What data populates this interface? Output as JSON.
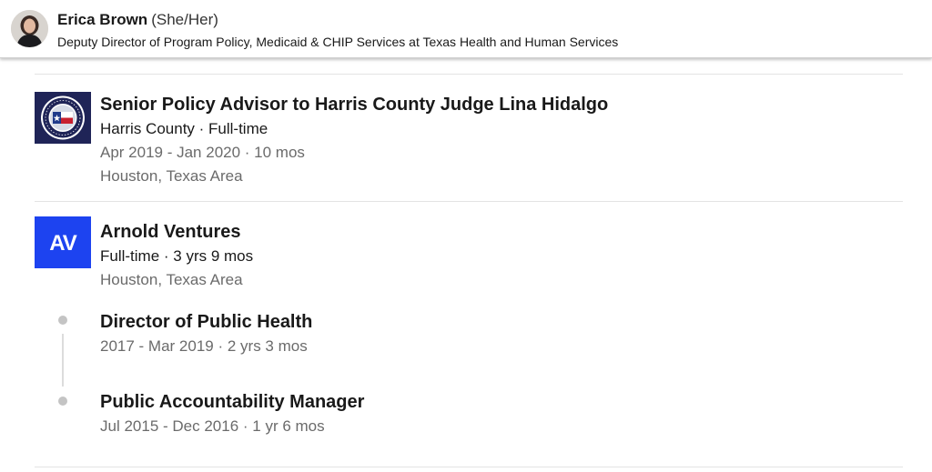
{
  "header": {
    "name": "Erica Brown",
    "pronouns": "(She/Her)",
    "headline": "Deputy Director of Program Policy, Medicaid & CHIP Services at Texas Health and Human Services"
  },
  "experience": [
    {
      "logo": "harris-county-seal-logo",
      "title": "Senior Policy Advisor to Harris County Judge Lina Hidalgo",
      "company_line": "Harris County · Full-time",
      "dates": "Apr 2019 - Jan 2020 · 10 mos",
      "location": "Houston, Texas Area"
    },
    {
      "logo": "arnold-ventures-logo",
      "logo_text": "AV",
      "company": "Arnold Ventures",
      "tenure": "Full-time · 3 yrs 9 mos",
      "location": "Houston, Texas Area",
      "roles": [
        {
          "title": "Director of Public Health",
          "dates": "2017 - Mar 2019 · 2 yrs 3 mos"
        },
        {
          "title": "Public Accountability Manager",
          "dates": "Jul 2015 - Dec 2016 · 1 yr 6 mos"
        }
      ]
    }
  ],
  "colors": {
    "harris_logo_bg": "#1f2457",
    "av_logo_bg": "#1d43f0",
    "meta_text": "#6b6b6b"
  }
}
